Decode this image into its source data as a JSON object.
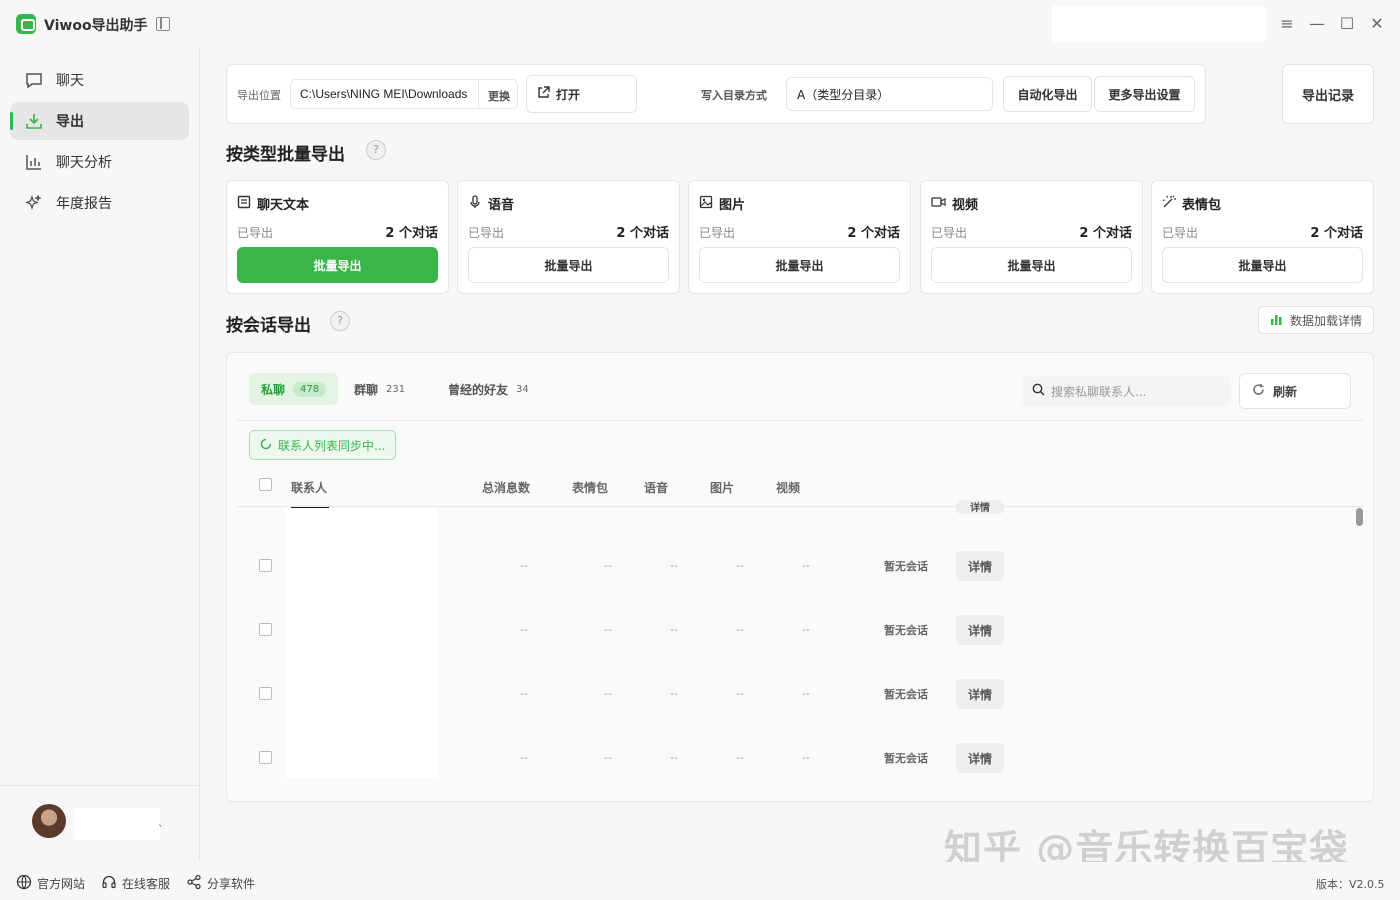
{
  "app": {
    "title": "Viwoo导出助手"
  },
  "sidebar": {
    "items": [
      {
        "label": "聊天",
        "icon": "chat-icon"
      },
      {
        "label": "导出",
        "icon": "download-icon"
      },
      {
        "label": "聊天分析",
        "icon": "bar-chart-icon"
      },
      {
        "label": "年度报告",
        "icon": "sparkle-icon"
      }
    ],
    "active_index": 1
  },
  "toolbar": {
    "export_location_label": "导出位置",
    "export_path": "C:\\Users\\NING MEI\\Downloads",
    "change_label": "更换",
    "open_label": "打开",
    "dir_mode_label": "写入目录方式",
    "dir_mode_value": "A（类型分目录）",
    "auto_export_label": "自动化导出",
    "more_settings_label": "更多导出设置",
    "history_label": "导出记录"
  },
  "batch_section": {
    "title": "按类型批量导出",
    "help": "?",
    "cards": [
      {
        "name": "聊天文本",
        "exported_label": "已导出",
        "count": "2 个对话",
        "button": "批量导出",
        "primary": true,
        "icon": "document-icon"
      },
      {
        "name": "语音",
        "exported_label": "已导出",
        "count": "2 个对话",
        "button": "批量导出",
        "primary": false,
        "icon": "mic-icon"
      },
      {
        "name": "图片",
        "exported_label": "已导出",
        "count": "2 个对话",
        "button": "批量导出",
        "primary": false,
        "icon": "image-icon"
      },
      {
        "name": "视频",
        "exported_label": "已导出",
        "count": "2 个对话",
        "button": "批量导出",
        "primary": false,
        "icon": "video-icon"
      },
      {
        "name": "表情包",
        "exported_label": "已导出",
        "count": "2 个对话",
        "button": "批量导出",
        "primary": false,
        "icon": "magic-wand-icon"
      }
    ]
  },
  "session_section": {
    "title": "按会话导出",
    "help": "?",
    "data_details_label": "数据加载详情",
    "tabs": [
      {
        "label": "私聊",
        "count": "478",
        "active": true
      },
      {
        "label": "群聊",
        "count": "231",
        "active": false
      },
      {
        "label": "曾经的好友",
        "count": "34",
        "active": false
      }
    ],
    "search_placeholder": "搜索私聊联系人...",
    "refresh_label": "刷新",
    "sync_status": "联系人列表同步中...",
    "columns": [
      "联系人",
      "总消息数",
      "表情包",
      "语音",
      "图片",
      "视频"
    ],
    "rows": [
      {
        "values": [
          "--",
          "--",
          "--",
          "--",
          "--"
        ],
        "status": "暂无会话",
        "action": "详情"
      },
      {
        "values": [
          "--",
          "--",
          "--",
          "--",
          "--"
        ],
        "status": "暂无会话",
        "action": "详情"
      },
      {
        "values": [
          "--",
          "--",
          "--",
          "--",
          "--"
        ],
        "status": "暂无会话",
        "action": "详情"
      },
      {
        "values": [
          "--",
          "--",
          "--",
          "--",
          "--"
        ],
        "status": "暂无会话",
        "action": "详情"
      }
    ],
    "partial_row_action": "详情"
  },
  "footer": {
    "website_label": "官方网站",
    "support_label": "在线客服",
    "share_label": "分享软件",
    "version": "版本：V2.0.5"
  },
  "watermark": "知乎 @音乐转换百宝袋",
  "colors": {
    "accent": "#3ab54a"
  }
}
